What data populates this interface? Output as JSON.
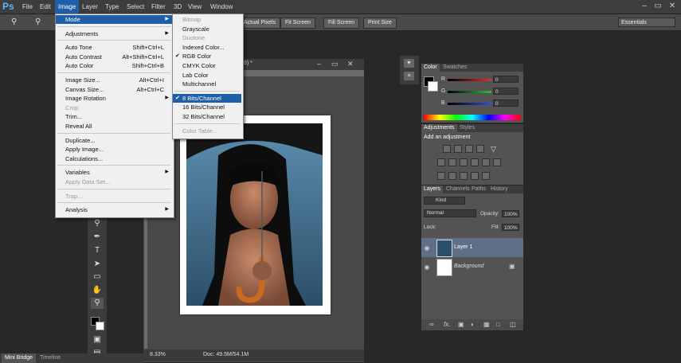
{
  "menubar": {
    "logo": "Ps",
    "items": [
      "File",
      "Edit",
      "Image",
      "Layer",
      "Type",
      "Select",
      "Filter",
      "3D",
      "View",
      "Window"
    ],
    "active": "Image"
  },
  "window_controls": {
    "minimize": "–",
    "restore": "▭",
    "close": "✕"
  },
  "options_bar": {
    "buttons": [
      "Actual Pixels",
      "Fit Screen",
      "Fill Screen",
      "Print Size"
    ],
    "workspace": "Essentials"
  },
  "document": {
    "title_fragment": "8) *",
    "zoom": "8.33%",
    "doc_size": "Doc: 49.5M/54.1M"
  },
  "image_menu": {
    "items": [
      {
        "label": "Mode",
        "shortcut": "",
        "submenu": true,
        "highlight": true,
        "disabled": false
      },
      {
        "label": "Adjustments",
        "shortcut": "",
        "submenu": true,
        "disabled": false
      },
      {
        "label": "Auto Tone",
        "shortcut": "Shift+Ctrl+L",
        "disabled": false
      },
      {
        "label": "Auto Contrast",
        "shortcut": "Alt+Shift+Ctrl+L",
        "disabled": false
      },
      {
        "label": "Auto Color",
        "shortcut": "Shift+Ctrl+B",
        "disabled": false
      },
      {
        "label": "Image Size...",
        "shortcut": "Alt+Ctrl+I",
        "disabled": false
      },
      {
        "label": "Canvas Size...",
        "shortcut": "Alt+Ctrl+C",
        "disabled": false
      },
      {
        "label": "Image Rotation",
        "shortcut": "",
        "submenu": true,
        "disabled": false
      },
      {
        "label": "Crop",
        "shortcut": "",
        "disabled": true
      },
      {
        "label": "Trim...",
        "shortcut": "",
        "disabled": false
      },
      {
        "label": "Reveal All",
        "shortcut": "",
        "disabled": false
      },
      {
        "label": "Duplicate...",
        "shortcut": "",
        "disabled": false
      },
      {
        "label": "Apply Image...",
        "shortcut": "",
        "disabled": false
      },
      {
        "label": "Calculations...",
        "shortcut": "",
        "disabled": false
      },
      {
        "label": "Variables",
        "shortcut": "",
        "submenu": true,
        "disabled": false
      },
      {
        "label": "Apply Data Set...",
        "shortcut": "",
        "disabled": true
      },
      {
        "label": "Trap...",
        "shortcut": "",
        "disabled": true
      },
      {
        "label": "Analysis",
        "shortcut": "",
        "submenu": true,
        "disabled": false
      }
    ]
  },
  "mode_menu": {
    "items": [
      {
        "label": "Bitmap",
        "disabled": true
      },
      {
        "label": "Grayscale",
        "disabled": false
      },
      {
        "label": "Duotone",
        "disabled": true
      },
      {
        "label": "Indexed Color...",
        "disabled": false
      },
      {
        "label": "RGB Color",
        "disabled": false,
        "checked": true
      },
      {
        "label": "CMYK Color",
        "disabled": false
      },
      {
        "label": "Lab Color",
        "disabled": false
      },
      {
        "label": "Multichannel",
        "disabled": false
      },
      {
        "label": "8 Bits/Channel",
        "disabled": false,
        "checked": true,
        "highlight": true
      },
      {
        "label": "16 Bits/Channel",
        "disabled": false
      },
      {
        "label": "32 Bits/Channel",
        "disabled": false
      },
      {
        "label": "Color Table...",
        "disabled": true
      }
    ],
    "check_glyph": "✔"
  },
  "color_panel": {
    "tabs": [
      "Color",
      "Swatches"
    ],
    "channels": [
      {
        "label": "R",
        "value": "0",
        "color": "#e03030"
      },
      {
        "label": "G",
        "value": "0",
        "color": "#30c030"
      },
      {
        "label": "B",
        "value": "0",
        "color": "#3050e0"
      }
    ]
  },
  "adjustments_panel": {
    "tabs": [
      "Adjustments",
      "Styles"
    ],
    "heading": "Add an adjustment"
  },
  "layers_panel": {
    "tabs": [
      "Layers",
      "Channels",
      "Paths",
      "History"
    ],
    "filter": "Kind",
    "blend_mode": "Normal",
    "opacity_label": "Opacity:",
    "opacity": "100%",
    "lock_label": "Lock:",
    "fill_label": "Fill:",
    "fill": "100%",
    "layers": [
      {
        "name": "Layer 1",
        "selected": true
      },
      {
        "name": "Background",
        "selected": false,
        "locked": true
      }
    ],
    "footer_icons": [
      "link-icon",
      "fx-icon",
      "mask-icon",
      "adjustment-icon",
      "group-icon",
      "new-layer-icon",
      "trash-icon"
    ],
    "fx_label": "fx."
  },
  "bottom_tabs": [
    "Mini Bridge",
    "Timeline"
  ]
}
